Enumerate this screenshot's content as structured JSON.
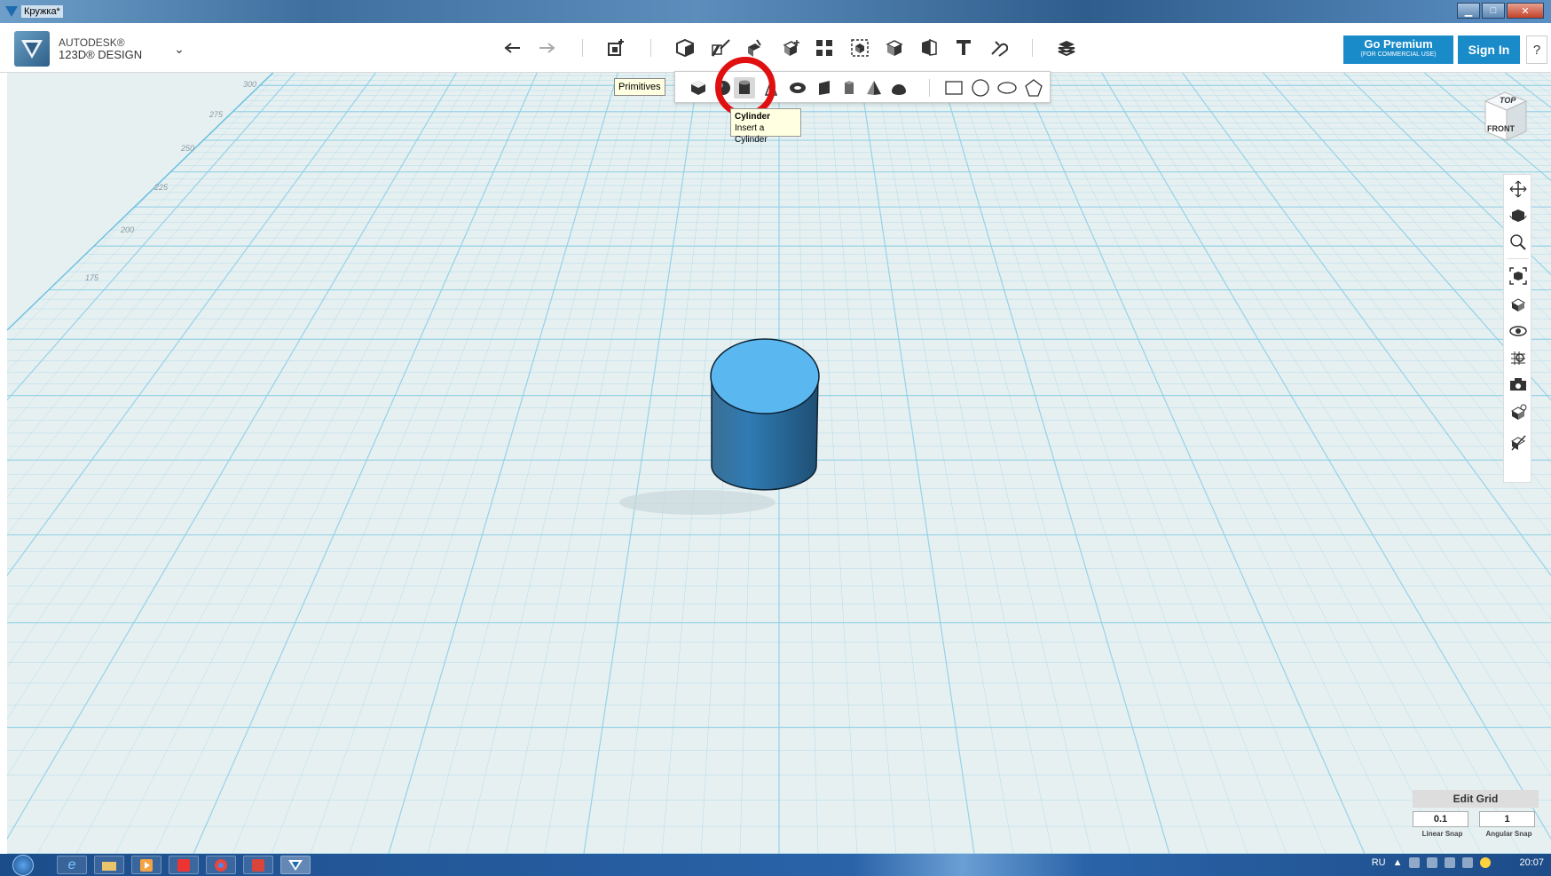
{
  "window": {
    "title": "Кружка*",
    "buttons": [
      "minimize",
      "maximize",
      "close"
    ]
  },
  "brand": {
    "line1": "AUTODESK®",
    "line2": "123D® DESIGN"
  },
  "toolbar": {
    "icons": [
      "undo-icon",
      "redo-icon",
      "new-shape-icon",
      "primitives-icon",
      "sketch-icon",
      "construct-icon",
      "modify-icon",
      "pattern-icon",
      "group-icon",
      "combine-icon",
      "measure-icon",
      "text-icon",
      "snap-icon",
      "material-icon"
    ]
  },
  "account": {
    "premium_label": "Go Premium",
    "premium_sub": "(FOR COMMERCIAL USE)",
    "signin_label": "Sign In",
    "help_label": "?"
  },
  "primitives": {
    "label": "Primitives",
    "tooltip_title": "Cylinder",
    "tooltip_desc": "Insert a Cylinder",
    "items": [
      "box",
      "sphere",
      "cylinder",
      "cone",
      "torus",
      "wedge",
      "prism",
      "pyramid",
      "hemisphere",
      "rectangle",
      "circle",
      "ellipse",
      "polygon"
    ],
    "active": "cylinder"
  },
  "viewcube": {
    "top": "TOP",
    "front": "FRONT"
  },
  "grid": {
    "ruler_labels": [
      "300",
      "275",
      "250",
      "225",
      "200",
      "175"
    ]
  },
  "navigation": {
    "icons": [
      "pan-icon",
      "orbit-icon",
      "zoom-icon",
      "fit-icon",
      "view-icon",
      "visibility-icon",
      "grid-icon",
      "camera-icon",
      "material-view-icon",
      "snap-view-icon"
    ]
  },
  "edit_grid": {
    "title": "Edit Grid",
    "linear_value": "0.1",
    "linear_label": "Linear Snap",
    "angular_value": "1",
    "angular_label": "Angular Snap"
  },
  "taskbar": {
    "lang": "RU",
    "time": "20:07"
  },
  "colors": {
    "accent": "#1a8bc9",
    "grid_line": "#8fcfe6",
    "cylinder_top": "#5bb7f0",
    "cylinder_side": "#2b6b99"
  }
}
